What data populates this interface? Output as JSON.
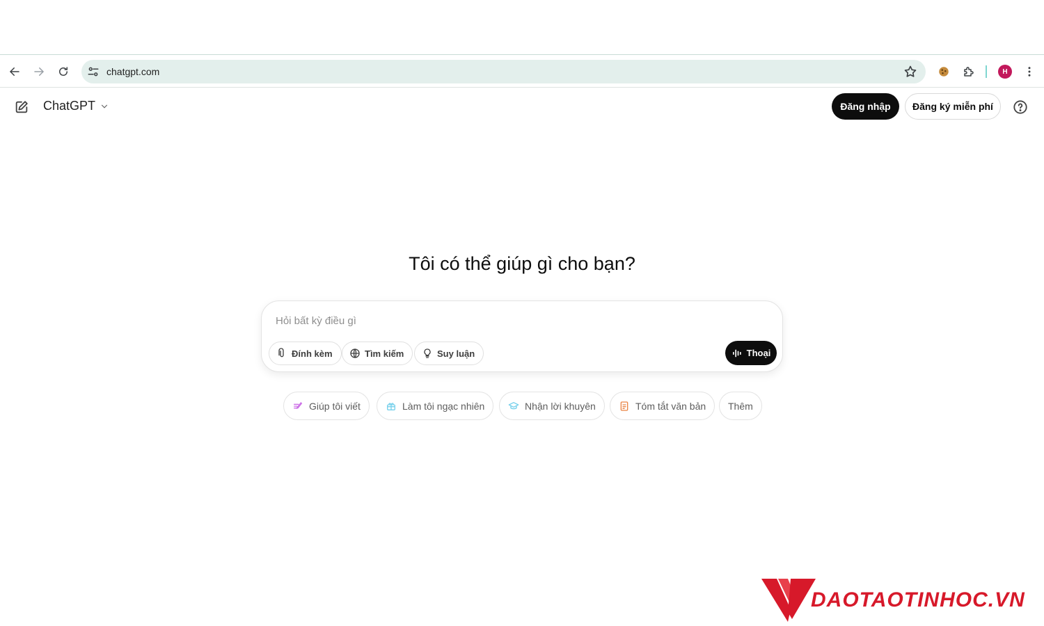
{
  "browser": {
    "url": "chatgpt.com",
    "profile_initial": "H",
    "accent_colors": {
      "omnibox_bg": "#e3efec",
      "avatar_bg": "#c2185b"
    },
    "icons": [
      "back-icon",
      "forward-icon",
      "reload-icon",
      "site-info-icon",
      "bookmark-star-icon",
      "cookie-extension-icon",
      "extensions-puzzle-icon",
      "menu-dots-icon"
    ]
  },
  "header": {
    "model_name": "ChatGPT",
    "login_label": "Đăng nhập",
    "signup_label": "Đăng ký miễn phí"
  },
  "main": {
    "heading": "Tôi có thể giúp gì cho bạn?",
    "composer": {
      "placeholder": "Hỏi bất kỳ điều gì",
      "tools": [
        {
          "label": "Đính kèm",
          "icon": "paperclip-icon"
        },
        {
          "label": "Tìm kiếm",
          "icon": "globe-icon"
        },
        {
          "label": "Suy luận",
          "icon": "lightbulb-icon"
        }
      ],
      "voice_label": "Thoại"
    },
    "suggestions": [
      {
        "label": "Giúp tôi viết",
        "icon": "pen-icon",
        "color": "#cb6ce6"
      },
      {
        "label": "Làm tôi ngạc nhiên",
        "icon": "gift-icon",
        "color": "#76d0eb"
      },
      {
        "label": "Nhận lời khuyên",
        "icon": "graduation-cap-icon",
        "color": "#76d0eb"
      },
      {
        "label": "Tóm tắt văn bản",
        "icon": "document-icon",
        "color": "#ea8444"
      },
      {
        "label": "Thêm",
        "icon": "",
        "color": "#5d5d5d"
      }
    ]
  },
  "watermark": {
    "text": "DAOTAOTINHOC.VN",
    "color": "#d7192a"
  }
}
